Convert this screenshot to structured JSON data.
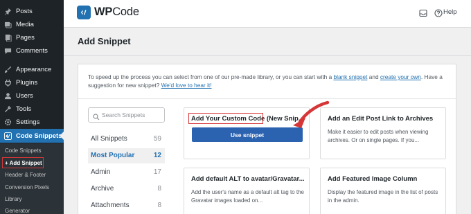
{
  "sidebar": {
    "items": [
      {
        "label": "Posts",
        "icon": "pin-icon"
      },
      {
        "label": "Media",
        "icon": "media-icon"
      },
      {
        "label": "Pages",
        "icon": "pages-icon"
      },
      {
        "label": "Comments",
        "icon": "comments-icon"
      },
      {
        "label": "Appearance",
        "icon": "brush-icon"
      },
      {
        "label": "Plugins",
        "icon": "plug-icon"
      },
      {
        "label": "Users",
        "icon": "users-icon"
      },
      {
        "label": "Tools",
        "icon": "wrench-icon"
      },
      {
        "label": "Settings",
        "icon": "settings-icon"
      },
      {
        "label": "Code Snippets",
        "icon": "code-snippets-icon"
      }
    ],
    "submenu": [
      "Code Snippets",
      "+ Add Snippet",
      "Header & Footer",
      "Conversion Pixels",
      "Library",
      "Generator"
    ]
  },
  "header": {
    "brand_prefix": "WP",
    "brand_suffix": "Code",
    "help_label": "Help"
  },
  "page": {
    "title": "Add Snippet"
  },
  "intro": {
    "text_1": "To speed up the process you can select from one of our pre-made library, or you can start with a ",
    "blank_link": "blank snippet",
    "text_2": " and ",
    "create_link": "create your own",
    "text_3": ". Have a suggestion for new snippet? ",
    "hear_link": "We'd love to hear it!"
  },
  "search": {
    "placeholder": "Search Snippets"
  },
  "categories": [
    {
      "label": "All Snippets",
      "count": "59"
    },
    {
      "label": "Most Popular",
      "count": "12"
    },
    {
      "label": "Admin",
      "count": "17"
    },
    {
      "label": "Archive",
      "count": "8"
    },
    {
      "label": "Attachments",
      "count": "8"
    }
  ],
  "cards": [
    {
      "title": "Add Your Custom Code (New Snip...",
      "button": "Use snippet"
    },
    {
      "title": "Add an Edit Post Link to Archives",
      "desc": "Make it easier to edit posts when viewing archives. Or on single pages. If you..."
    },
    {
      "title": "Add default ALT to avatar/Gravatar...",
      "desc": "Add the user's name as a default alt tag to the Gravatar images loaded on..."
    },
    {
      "title": "Add Featured Image Column",
      "desc": "Display the featured image in the list of posts in the admin."
    }
  ],
  "colors": {
    "accent": "#2271b1",
    "annotation": "#d63638",
    "sidebar_bg": "#1d2327"
  }
}
